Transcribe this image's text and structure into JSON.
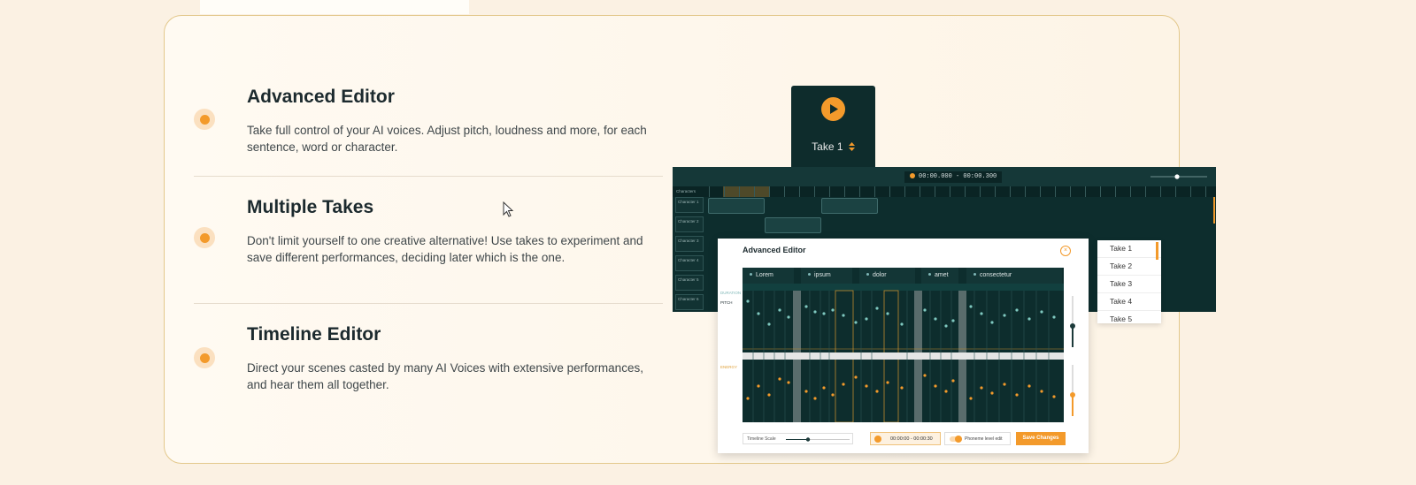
{
  "features": [
    {
      "title": "Advanced Editor",
      "description": "Take full control of your AI voices. Adjust pitch, loudness and more, for each sentence, word or character."
    },
    {
      "title": "Multiple Takes",
      "description": "Don't limit yourself to one creative alternative! Use takes to experiment and save different performances, deciding later which is the one."
    },
    {
      "title": "Timeline Editor",
      "description": "Direct your scenes casted by many AI Voices with extensive performances, and hear them all together."
    }
  ],
  "take_panel": {
    "label": "Take 1"
  },
  "timeline": {
    "time_range": "00:00.000 - 00:00.300",
    "ruler_label": "Characters",
    "characters": [
      "Character 1",
      "Character 2",
      "Character 3",
      "Character 4",
      "Character 5",
      "Character 6"
    ]
  },
  "takes_menu": [
    "Take 1",
    "Take 2",
    "Take 3",
    "Take 4",
    "Take 5"
  ],
  "advanced_editor": {
    "title": "Advanced Editor",
    "close_label": "×",
    "words": [
      "Lorem",
      "ipsum",
      "dolor",
      "amet",
      "consectetur"
    ],
    "duration_label": "DURATION",
    "pitch_label": "PITCH",
    "energy_label": "ENERGY",
    "timeline_scale_label": "Timeline Scale",
    "time_range": "00:00:00 - 00:00:30",
    "phoneme_label": "Phoneme level edit",
    "save_label": "Save Changes"
  },
  "colors": {
    "accent": "#f39a2b",
    "dark_teal": "#0d2d2d",
    "card_border": "#e3c88c",
    "background": "#fbf1e3"
  }
}
